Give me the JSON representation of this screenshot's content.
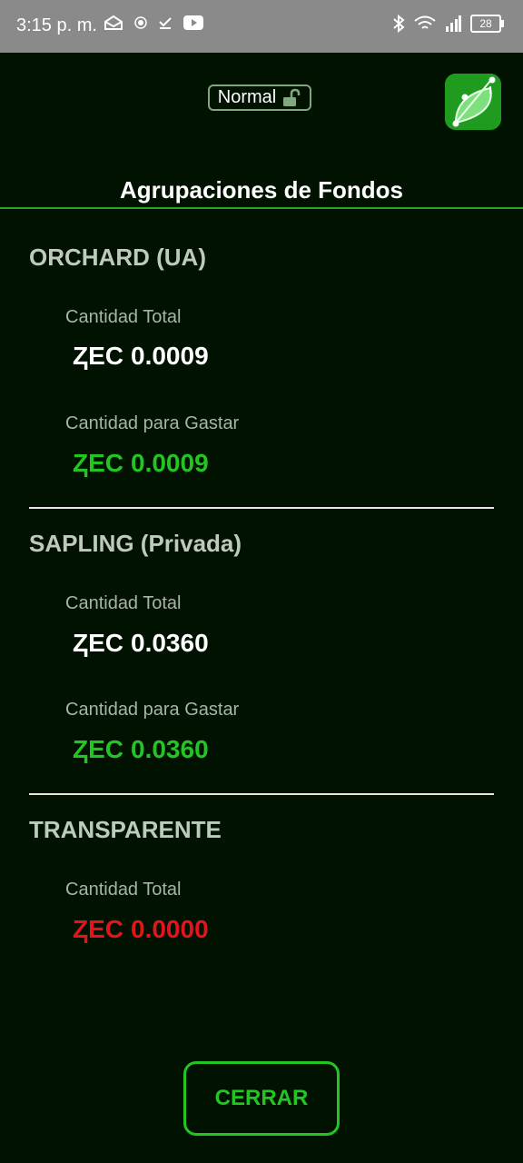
{
  "status_bar": {
    "time": "3:15 p. m.",
    "battery": "28"
  },
  "header": {
    "mode_label": "Normal"
  },
  "page": {
    "title": "Agrupaciones de Fondos"
  },
  "pools": [
    {
      "title": "ORCHARD (UA)",
      "total_label": "Cantidad Total",
      "total_symbol": "ⱫEC",
      "total_value": "0.0009",
      "spend_label": "Cantidad para Gastar",
      "spend_symbol": "ⱫEC",
      "spend_value": "0.0009"
    },
    {
      "title": "SAPLING (Privada)",
      "total_label": "Cantidad Total",
      "total_symbol": "ⱫEC",
      "total_value": "0.0360",
      "spend_label": "Cantidad para Gastar",
      "spend_symbol": "ⱫEC",
      "spend_value": "0.0360"
    },
    {
      "title": "TRANSPARENTE",
      "total_label": "Cantidad Total",
      "total_symbol": "ⱫEC",
      "total_value": "0.0000"
    }
  ],
  "footer": {
    "close_label": "CERRAR"
  },
  "colors": {
    "background": "#011201",
    "accent_green": "#22c522",
    "negative_red": "#e3141a"
  }
}
